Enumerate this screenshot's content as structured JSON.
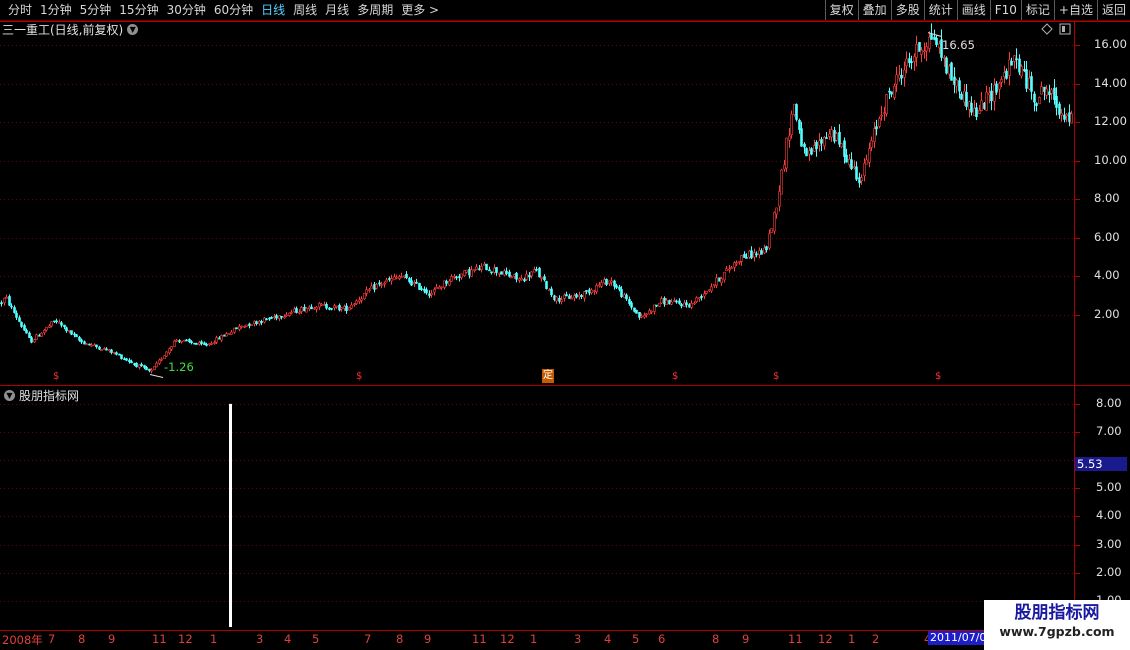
{
  "toolbar": {
    "periods": [
      "分时",
      "1分钟",
      "5分钟",
      "15分钟",
      "30分钟",
      "60分钟",
      "日线",
      "周线",
      "月线",
      "多周期",
      "更多 >"
    ],
    "active_period": "日线",
    "right_buttons": [
      "复权",
      "叠加",
      "多股",
      "统计",
      "画线",
      "F10",
      "标记",
      "+自选",
      "返回"
    ]
  },
  "main_chart": {
    "stock_name": "三一重工(日线,前复权)",
    "y_ticks": [
      "16.00",
      "14.00",
      "12.00",
      "10.00",
      "8.00",
      "6.00",
      "4.00",
      "2.00"
    ],
    "high_label": "16.65",
    "low_label": "-1.26",
    "marker_label": "定",
    "signal_marks": [
      "$",
      "$",
      "$",
      "$",
      "$"
    ]
  },
  "indicator": {
    "name": "股朋指标网",
    "y_ticks": [
      "8.00",
      "7.00",
      "5.00",
      "4.00",
      "3.00",
      "2.00",
      "1.00"
    ],
    "current_value": "5.53"
  },
  "x_axis": {
    "ticks": [
      "2008年",
      "7",
      "8",
      "9",
      "11",
      "12",
      "1",
      "3",
      "4",
      "5",
      "7",
      "8",
      "9",
      "11",
      "12",
      "1",
      "3",
      "4",
      "5",
      "6",
      "8",
      "9",
      "11",
      "12",
      "1",
      "2",
      "4"
    ],
    "cursor_date": "2011/07/0"
  },
  "watermark": {
    "title": "股朋指标网",
    "url": "www.7gpzb.com"
  },
  "colors": {
    "up": "#ff3c3c",
    "down": "#54ffff",
    "grid": "#6a0000",
    "accent": "#5ad0ff"
  },
  "chart_data": {
    "type": "candlestick",
    "ylim": [
      -1.6,
      17.2
    ],
    "y_ticks": [
      2,
      4,
      6,
      8,
      10,
      12,
      14,
      16
    ],
    "high": 16.65,
    "low": -1.26,
    "indicator_ylim": [
      0,
      8.6
    ],
    "indicator_value": 5.53,
    "indicator_spike_value": 8.0,
    "anchors": [
      [
        0,
        2.6
      ],
      [
        5,
        2.9
      ],
      [
        30,
        0.6
      ],
      [
        55,
        1.7
      ],
      [
        80,
        0.6
      ],
      [
        110,
        0.1
      ],
      [
        150,
        -1.0
      ],
      [
        175,
        0.7
      ],
      [
        205,
        0.4
      ],
      [
        240,
        1.4
      ],
      [
        275,
        1.9
      ],
      [
        315,
        2.5
      ],
      [
        345,
        2.3
      ],
      [
        375,
        3.5
      ],
      [
        400,
        4.0
      ],
      [
        430,
        3.1
      ],
      [
        450,
        3.9
      ],
      [
        485,
        4.5
      ],
      [
        520,
        3.8
      ],
      [
        535,
        4.3
      ],
      [
        555,
        2.8
      ],
      [
        580,
        3.0
      ],
      [
        600,
        3.6
      ],
      [
        610,
        3.8
      ],
      [
        640,
        1.8
      ],
      [
        660,
        2.7
      ],
      [
        690,
        2.5
      ],
      [
        715,
        3.7
      ],
      [
        740,
        5.0
      ],
      [
        765,
        5.3
      ],
      [
        775,
        7.5
      ],
      [
        793,
        13.0
      ],
      [
        805,
        10.0
      ],
      [
        830,
        11.6
      ],
      [
        860,
        9.0
      ],
      [
        880,
        12.5
      ],
      [
        900,
        14.6
      ],
      [
        918,
        15.8
      ],
      [
        933,
        16.5
      ],
      [
        950,
        14.4
      ],
      [
        975,
        12.4
      ],
      [
        995,
        13.8
      ],
      [
        1015,
        15.3
      ],
      [
        1035,
        13.2
      ],
      [
        1045,
        13.8
      ],
      [
        1060,
        12.6
      ],
      [
        1075,
        11.9
      ]
    ]
  }
}
